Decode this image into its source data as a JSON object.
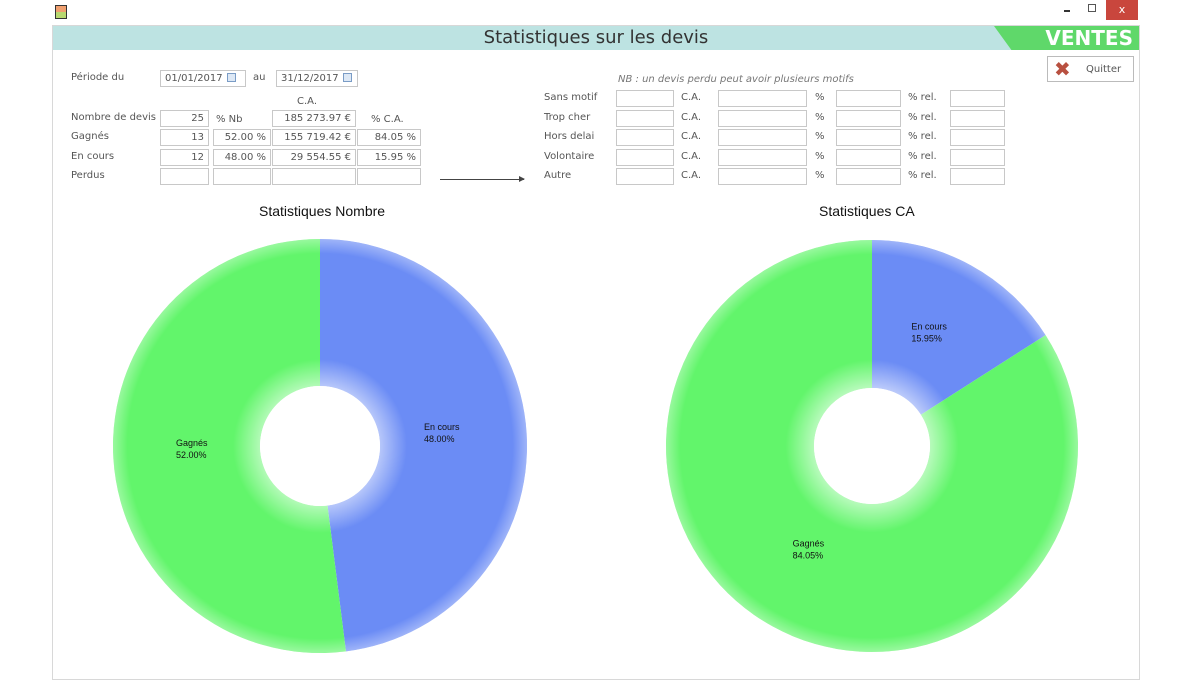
{
  "window": {
    "title": "Statistiques sur les devis",
    "badge": "VENTES",
    "controls": [
      "minimize",
      "maximize",
      "close"
    ]
  },
  "quit_label": "Quitter",
  "period": {
    "label_from": "Période du",
    "from": "01/01/2017",
    "label_to": "au",
    "to": "31/12/2017"
  },
  "summary": {
    "col_ca": "C.A.",
    "col_pct_nb": "% Nb",
    "col_pct_ca": "% C.A.",
    "rows": [
      {
        "label": "Nombre de devis",
        "nb": "25",
        "pct_nb": "",
        "ca": "185 273.97 €",
        "pct_ca": ""
      },
      {
        "label": "Gagnés",
        "nb": "13",
        "pct_nb": "52.00 %",
        "ca": "155 719.42 €",
        "pct_ca": "84.05 %"
      },
      {
        "label": "En cours",
        "nb": "12",
        "pct_nb": "48.00 %",
        "ca": "29 554.55 €",
        "pct_ca": "15.95 %"
      },
      {
        "label": "Perdus",
        "nb": "",
        "pct_nb": "",
        "ca": "",
        "pct_ca": ""
      }
    ]
  },
  "motifs": {
    "note": "NB : un devis perdu peut avoir plusieurs motifs",
    "ca_label": "C.A.",
    "pct_label": "%",
    "rel_label": "% rel.",
    "rows": [
      "Sans motif",
      "Trop cher",
      "Hors delai",
      "Volontaire",
      "Autre"
    ]
  },
  "chart_data": [
    {
      "type": "pie",
      "donut": true,
      "title": "Statistiques Nombre",
      "slices": [
        {
          "label": "En cours",
          "value": 48.0,
          "text": "48.00%",
          "color": "#6b8cf5"
        },
        {
          "label": "Gagnés",
          "value": 52.0,
          "text": "52.00%",
          "color": "#62f56b"
        }
      ]
    },
    {
      "type": "pie",
      "donut": true,
      "title": "Statistiques CA",
      "slices": [
        {
          "label": "En cours",
          "value": 15.95,
          "text": "15.95%",
          "color": "#6b8cf5"
        },
        {
          "label": "Gagnés",
          "value": 84.05,
          "text": "84.05%",
          "color": "#62f56b"
        }
      ]
    }
  ]
}
